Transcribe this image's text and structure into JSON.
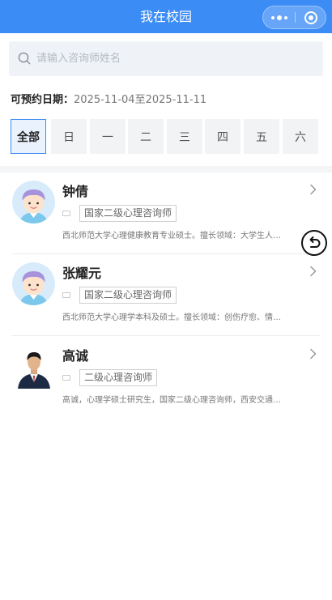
{
  "nav": {
    "title": "我在校园"
  },
  "search": {
    "placeholder": "请输入咨询师姓名"
  },
  "booking": {
    "label": "可预约日期：",
    "range": "2025-11-04至2025-11-11"
  },
  "days": [
    "全部",
    "日",
    "一",
    "二",
    "三",
    "四",
    "五",
    "六"
  ],
  "selected_day": "全部",
  "counselors": [
    {
      "name": "钟倩",
      "title": "国家二级心理咨询师",
      "desc": "西北师范大学心理健康教育专业硕士。擅长领域：大学生人际关系、情绪管理",
      "avatar": "cartoon-avatar"
    },
    {
      "name": "张耀元",
      "title": "国家二级心理咨询师",
      "desc": "西北师范大学心理学本科及硕士。擅长领域：创伤疗愈、情绪调节",
      "avatar": "cartoon-avatar"
    },
    {
      "name": "高诚",
      "title": "二级心理咨询师",
      "desc": "高诚，心理学硕士研究生，国家二级心理咨询师，西安交通大学",
      "avatar": "photo-avatar"
    }
  ],
  "colors": {
    "primary": "#3c8cf5",
    "search_bg": "#eff3f8",
    "day_bg": "#f2f3f5"
  }
}
